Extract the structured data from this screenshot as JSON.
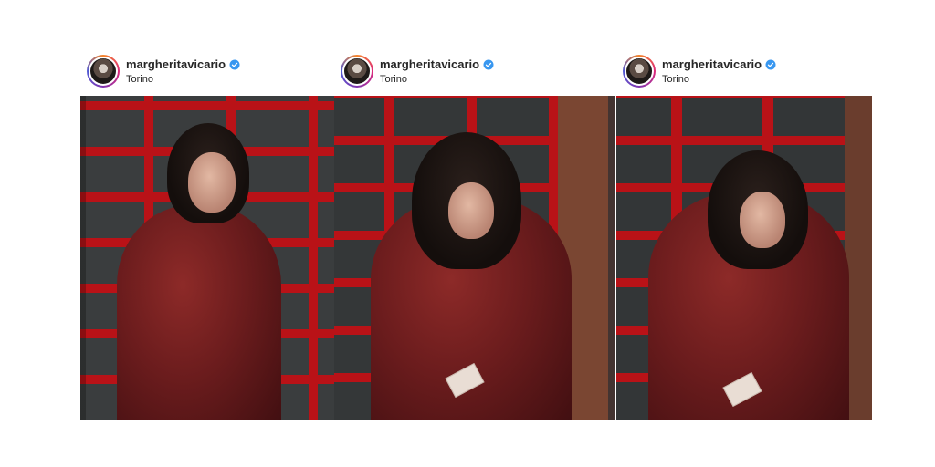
{
  "posts": [
    {
      "username": "margheritavicario",
      "location": "Torino"
    },
    {
      "username": "margheritavicario",
      "location": "Torino"
    },
    {
      "username": "margheritavicario",
      "location": "Torino"
    }
  ],
  "icons": {
    "verified": "verified-badge-icon",
    "verified_color": "#3897f0"
  },
  "colors": {
    "door_red": "#b91217",
    "coat_red": "#6b1c1d"
  }
}
